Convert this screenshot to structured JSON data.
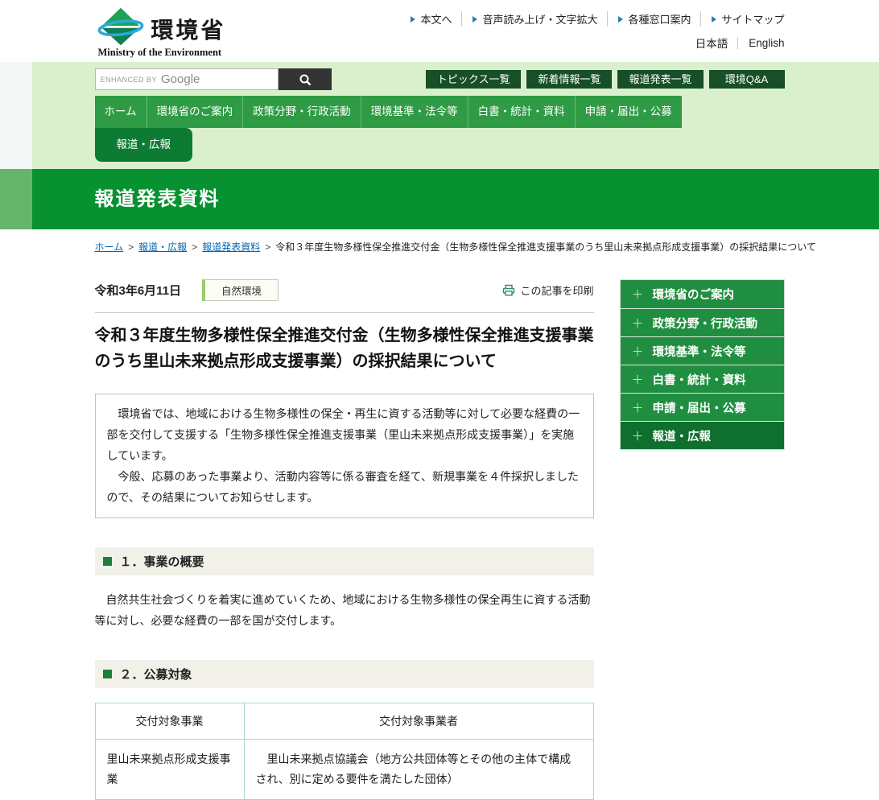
{
  "header": {
    "logo": {
      "title": "環境省",
      "subtitle": "Ministry of the Environment"
    },
    "utility_links": [
      "本文へ",
      "音声読み上げ・文字拡大",
      "各種窓口案内",
      "サイトマップ"
    ],
    "lang_links": [
      "日本語",
      "English"
    ]
  },
  "search": {
    "enhanced_by": "ENHANCED BY",
    "google": "Google"
  },
  "quick_links": [
    "トピックス一覧",
    "新着情報一覧",
    "報道発表一覧",
    "環境Q&A"
  ],
  "nav": {
    "items": [
      "ホーム",
      "環境省のご案内",
      "政策分野・行政活動",
      "環境基準・法令等",
      "白書・統計・資料",
      "申請・届出・公募"
    ],
    "active_tab": "報道・広報"
  },
  "page_title": "報道発表資料",
  "breadcrumb": {
    "separator": ">",
    "links": [
      "ホーム",
      "報道・広報",
      "報道発表資料"
    ],
    "current": "令和３年度生物多様性保全推進交付金（生物多様性保全推進支援事業のうち里山未来拠点形成支援事業）の採択結果について"
  },
  "article": {
    "date": "令和3年6月11日",
    "category": "自然環境",
    "print_label": "この記事を印刷",
    "title": "令和３年度生物多様性保全推進交付金（生物多様性保全推進支援事業のうち里山未来拠点形成支援事業）の採択結果について",
    "summary": [
      "　環境省では、地域における生物多様性の保全・再生に資する活動等に対して必要な経費の一部を交付して支援する「生物多様性保全推進支援事業（里山未来拠点形成支援事業）」を実施しています。",
      "　今般、応募のあった事業より、活動内容等に係る審査を経て、新規事業を４件採択しましたので、その結果についてお知らせします。"
    ],
    "sections": [
      {
        "heading": "１．事業の概要",
        "body": "　自然共生社会づくりを着実に進めていくため、地域における生物多様性の保全再生に資する活動等に対し、必要な経費の一部を国が交付します。"
      },
      {
        "heading": "２．公募対象"
      }
    ],
    "table": {
      "headers": [
        "交付対象事業",
        "交付対象事業者"
      ],
      "rows": [
        [
          "里山未来拠点形成支援事業",
          "　里山未来拠点協議会（地方公共団体等とその他の主体で構成され、別に定める要件を満たした団体）"
        ]
      ]
    }
  },
  "sidebar": {
    "items": [
      {
        "label": "環境省のご案内"
      },
      {
        "label": "政策分野・行政活動"
      },
      {
        "label": "環境基準・法令等"
      },
      {
        "label": "白書・統計・資料"
      },
      {
        "label": "申請・届出・公募"
      },
      {
        "label": "報道・広報"
      }
    ]
  },
  "icons": {
    "plus": "＋"
  },
  "colors": {
    "title_band_green": "#089130",
    "nav_green": "#2f9b45",
    "active_tab_green": "#0d7c32",
    "sidebar_green": "#208e40",
    "sidebar_active_green": "#0f6f2f",
    "quick_button_green": "#174f27",
    "band_light_green": "#daf0cc",
    "link_blue": "#0066b3",
    "table_border_teal": "#a6d6c4",
    "category_tag_border": "#9aca6a",
    "print_icon_teal": "#2e8b74"
  }
}
